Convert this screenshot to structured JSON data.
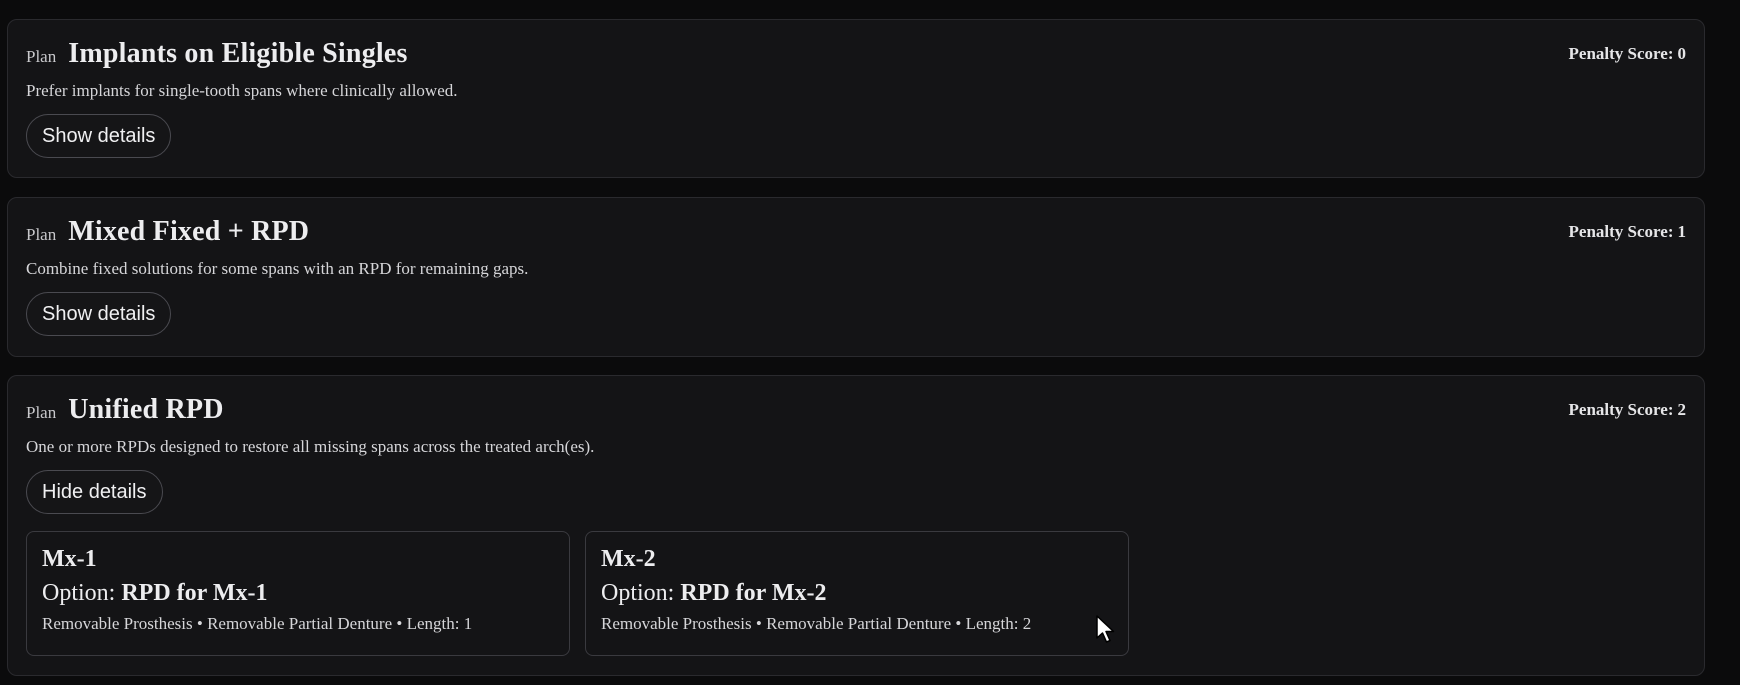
{
  "plans": [
    {
      "kicker": "Plan",
      "title": "Implants on Eligible Singles",
      "penalty_label": "Penalty Score:",
      "penalty_value": "0",
      "description": "Prefer implants for single-tooth spans where clinically allowed.",
      "toggle_label": "Show details"
    },
    {
      "kicker": "Plan",
      "title": "Mixed Fixed + RPD",
      "penalty_label": "Penalty Score:",
      "penalty_value": "1",
      "description": "Combine fixed solutions for some spans with an RPD for remaining gaps.",
      "toggle_label": "Show details"
    },
    {
      "kicker": "Plan",
      "title": "Unified RPD",
      "penalty_label": "Penalty Score:",
      "penalty_value": "2",
      "description": "One or more RPDs designed to restore all missing spans across the treated arch(es).",
      "toggle_label": "Hide details",
      "details": [
        {
          "title": "Mx-1",
          "option_prefix": "Option:",
          "option_value": "RPD for Mx-1",
          "meta": "Removable Prosthesis • Removable Partial Denture • Length: 1"
        },
        {
          "title": "Mx-2",
          "option_prefix": "Option:",
          "option_value": "RPD for Mx-2",
          "meta": "Removable Prosthesis • Removable Partial Denture • Length: 2"
        }
      ]
    }
  ],
  "icons": {
    "cursor": "mouse-pointer-icon"
  }
}
